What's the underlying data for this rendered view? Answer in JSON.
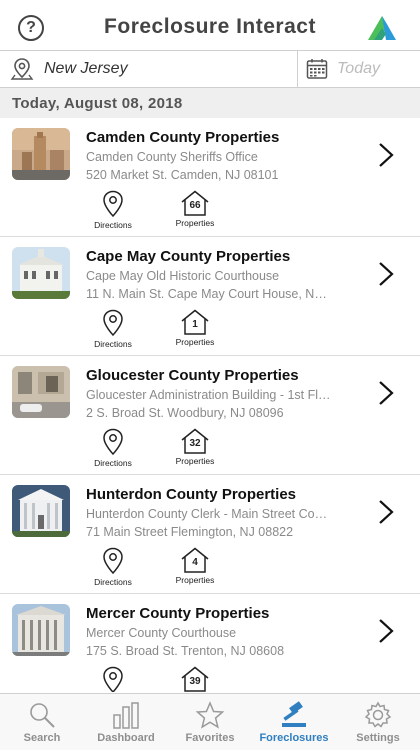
{
  "header": {
    "title": "Foreclosure Interact",
    "help_glyph": "?"
  },
  "filters": {
    "location": "New Jersey",
    "date_placeholder": "Today"
  },
  "date_heading": "Today, August 08, 2018",
  "actions": {
    "directions_label": "Directions",
    "properties_label": "Properties"
  },
  "properties": [
    {
      "name": "Camden County Properties",
      "place": "Camden County Sheriffs Office",
      "address": "520 Market St. Camden, NJ 08101",
      "count": "66"
    },
    {
      "name": "Cape May County Properties",
      "place": "Cape May Old Historic Courthouse",
      "address": "11 N. Main St. Cape May Court House, N…",
      "count": "1"
    },
    {
      "name": "Gloucester County Properties",
      "place": "Gloucester Administration Building - 1st Fl…",
      "address": "2 S. Broad St. Woodbury, NJ 08096",
      "count": "32"
    },
    {
      "name": "Hunterdon County Properties",
      "place": "Hunterdon County Clerk - Main Street Co…",
      "address": "71 Main Street Flemington, NJ 08822",
      "count": "4"
    },
    {
      "name": "Mercer County Properties",
      "place": "Mercer County Courthouse",
      "address": "175 S. Broad St. Trenton, NJ 08608",
      "count": "39"
    }
  ],
  "tabs": [
    {
      "label": "Search",
      "icon": "search-icon"
    },
    {
      "label": "Dashboard",
      "icon": "bar-chart-icon"
    },
    {
      "label": "Favorites",
      "icon": "star-icon"
    },
    {
      "label": "Foreclosures",
      "icon": "gavel-icon",
      "active": true
    },
    {
      "label": "Settings",
      "icon": "gear-icon"
    }
  ],
  "colors": {
    "accent": "#2f7fc1",
    "logo_green": "#4cbf5a",
    "logo_blue": "#2a9bd8"
  }
}
